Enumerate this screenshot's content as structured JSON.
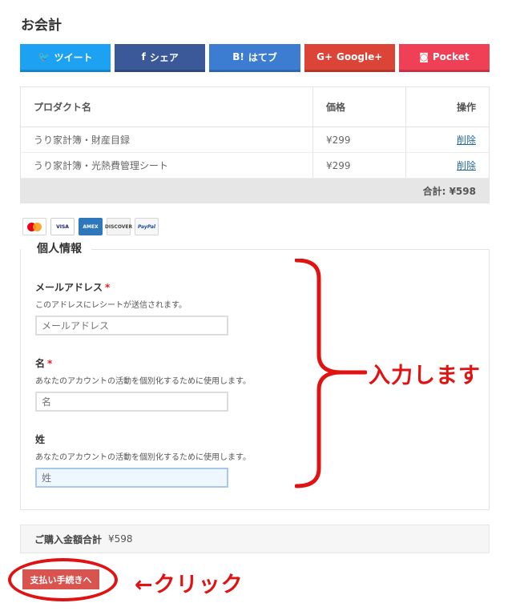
{
  "page": {
    "title": "お会計"
  },
  "share_buttons": [
    {
      "icon": "twitter-icon",
      "glyph": "🐦",
      "label": "ツイート",
      "color": "#1da1f2"
    },
    {
      "icon": "facebook-icon",
      "glyph": "f",
      "label": "シェア",
      "color": "#3b5998"
    },
    {
      "icon": "hatena-icon",
      "glyph": "B!",
      "label": "はてブ",
      "color": "#3c7dd1"
    },
    {
      "icon": "google-plus-icon",
      "glyph": "G+",
      "label": "Google+",
      "color": "#db4437"
    },
    {
      "icon": "pocket-icon",
      "glyph": "◙",
      "label": "Pocket",
      "color": "#ef4056"
    }
  ],
  "cart": {
    "headers": {
      "product": "プロダクト名",
      "price": "価格",
      "action": "操作"
    },
    "rows": [
      {
        "product": "うり家計簿・財産目録",
        "price": "¥299",
        "action": "削除"
      },
      {
        "product": "うり家計簿・光熱費管理シート",
        "price": "¥299",
        "action": "削除"
      }
    ],
    "total": "合計: ¥598"
  },
  "payment_cards": [
    {
      "name": "mastercard-icon",
      "label": "mastercard"
    },
    {
      "name": "visa-icon",
      "label": "VISA"
    },
    {
      "name": "amex-icon",
      "label": "AMEX"
    },
    {
      "name": "discover-icon",
      "label": "DISCOVER"
    },
    {
      "name": "paypal-icon",
      "label": "PayPal"
    }
  ],
  "personal_info": {
    "legend": "個人情報",
    "email": {
      "label": "メールアドレス",
      "required_mark": "*",
      "desc": "このアドレスにレシートが送信されます。",
      "placeholder": "メールアドレス",
      "value": ""
    },
    "first_name": {
      "label": "名",
      "required_mark": "*",
      "desc": "あなたのアカウントの活動を個別化するために使用します。",
      "placeholder": "名",
      "value": ""
    },
    "last_name": {
      "label": "姓",
      "desc": "あなたのアカウントの活動を個別化するために使用します。",
      "placeholder": "姓",
      "value": ""
    }
  },
  "annotations": {
    "input_note": "入力します",
    "click_note": "←クリック",
    "color": "#e01212"
  },
  "summary": {
    "label": "ご購入金額合計",
    "amount": "¥598"
  },
  "checkout": {
    "button_label": "支払い手続きへ"
  }
}
